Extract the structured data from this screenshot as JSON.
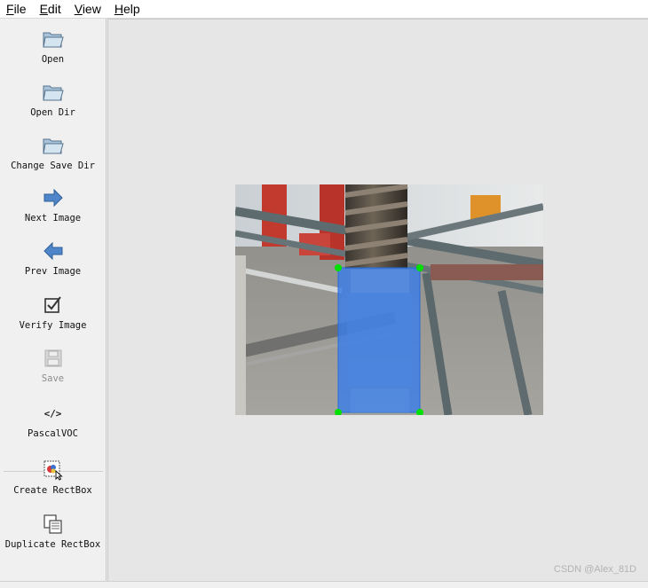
{
  "menu": {
    "items": [
      {
        "first": "F",
        "rest": "ile"
      },
      {
        "first": "E",
        "rest": "dit"
      },
      {
        "first": "V",
        "rest": "iew"
      },
      {
        "first": "H",
        "rest": "elp"
      }
    ]
  },
  "toolbar": {
    "open": "Open",
    "open_dir": "Open Dir",
    "change_save_dir": "Change Save Dir",
    "next_image": "Next Image",
    "prev_image": "Prev Image",
    "verify_image": "Verify Image",
    "save": "Save",
    "format_icon_text": "</>",
    "format": "PascalVOC",
    "create_rectbox": "Create RectBox",
    "duplicate_rectbox": "Duplicate RectBox"
  },
  "watermark": "CSDN @Alex_81D",
  "colors": {
    "annotation_fill": "#3a7ee8",
    "annotation_vertex": "#00e000",
    "canvas_bg": "#e6e6e6"
  }
}
